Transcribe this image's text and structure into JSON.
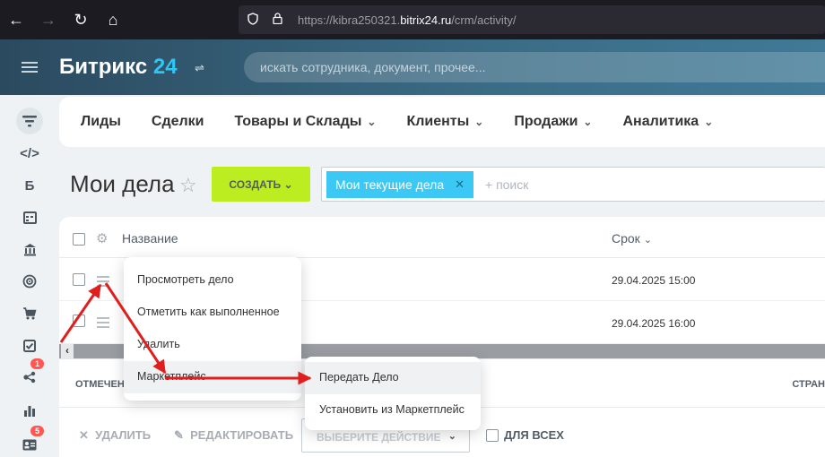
{
  "browser": {
    "url_prefix": "https://kibra250321.",
    "url_domain": "bitrix24.ru",
    "url_path": "/crm/activity/"
  },
  "header": {
    "logo_text": "Битрикс",
    "logo_num": "24",
    "search_placeholder": "искать сотрудника, документ, прочее..."
  },
  "sidebar": {
    "letter_item": "Б",
    "badges": [
      "1",
      "5"
    ]
  },
  "topmenu": {
    "items": [
      {
        "label": "Лиды"
      },
      {
        "label": "Сделки"
      },
      {
        "label": "Товары и Склады"
      },
      {
        "label": "Клиенты"
      },
      {
        "label": "Продажи"
      },
      {
        "label": "Аналитика"
      }
    ]
  },
  "page": {
    "title": "Мои дела",
    "create_label": "СОЗДАТЬ",
    "filter_chip": "Мои текущие дела",
    "filter_add": "+ поиск"
  },
  "grid": {
    "col_name": "Название",
    "col_deadline": "Срок",
    "rows": [
      {
        "deadline": "29.04.2025 15:00"
      },
      {
        "deadline": "29.04.2025 16:00"
      }
    ]
  },
  "footer": {
    "marked_label": "ОТМЕЧЕН",
    "pages_label": "СТРАН",
    "delete_label": "УДАЛИТЬ",
    "edit_label": "РЕДАКТИРОВАТЬ",
    "select_action": "ВЫБЕРИТЕ ДЕЙСТВИЕ",
    "for_all_label": "ДЛЯ ВСЕХ"
  },
  "context_menu": {
    "items": [
      {
        "label": "Просмотреть дело"
      },
      {
        "label": "Отметить как выполненное"
      },
      {
        "label": "Удалить"
      },
      {
        "label": "Маркетплейс"
      }
    ]
  },
  "sub_menu": {
    "items": [
      {
        "label": "Передать Дело"
      },
      {
        "label": "Установить из Маркетплейс"
      }
    ]
  },
  "colors": {
    "annotation_arrow": "#e01e1e",
    "create_button": "#bbed21",
    "filter_chip": "#3bc8f5"
  }
}
